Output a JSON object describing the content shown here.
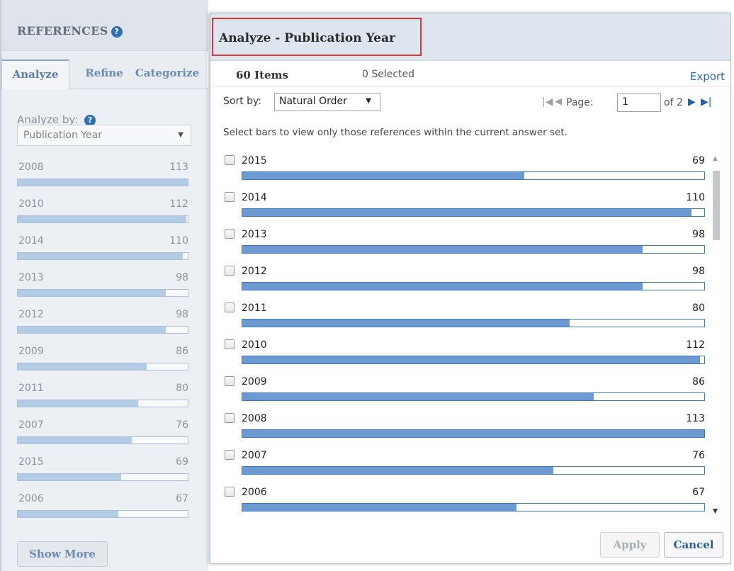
{
  "sidebar": {
    "title": "REFERENCES",
    "help_icon": "?",
    "tabs": [
      {
        "label": "Analyze",
        "active": true
      },
      {
        "label": "Refine",
        "active": false
      },
      {
        "label": "Categorize",
        "active": false
      }
    ],
    "analyze_by_label": "Analyze by:",
    "analyze_by_value": "Publication Year",
    "rows": [
      {
        "year": "2008",
        "count": "113",
        "fraction": 1.0
      },
      {
        "year": "2010",
        "count": "112",
        "fraction": 0.99
      },
      {
        "year": "2014",
        "count": "110",
        "fraction": 0.97
      },
      {
        "year": "2013",
        "count": "98",
        "fraction": 0.87
      },
      {
        "year": "2012",
        "count": "98",
        "fraction": 0.87
      },
      {
        "year": "2009",
        "count": "86",
        "fraction": 0.76
      },
      {
        "year": "2011",
        "count": "80",
        "fraction": 0.71
      },
      {
        "year": "2007",
        "count": "76",
        "fraction": 0.67
      },
      {
        "year": "2015",
        "count": "69",
        "fraction": 0.61
      },
      {
        "year": "2006",
        "count": "67",
        "fraction": 0.59
      }
    ],
    "show_more_label": "Show More"
  },
  "dialog": {
    "title": "Analyze - Publication Year",
    "items_count": "60 Items",
    "selected_count": "0 Selected",
    "export_label": "Export",
    "sort_label": "Sort by:",
    "sort_value": "Natural Order",
    "pager": {
      "page_label": "Page:",
      "current_page": "1",
      "total_label": "of 2"
    },
    "instructions": "Select bars to view only those references within the current answer set.",
    "rows": [
      {
        "year": "2015",
        "count": "69",
        "fraction": 0.61,
        "checked": false
      },
      {
        "year": "2014",
        "count": "110",
        "fraction": 0.973,
        "checked": false
      },
      {
        "year": "2013",
        "count": "98",
        "fraction": 0.867,
        "checked": false
      },
      {
        "year": "2012",
        "count": "98",
        "fraction": 0.867,
        "checked": false
      },
      {
        "year": "2011",
        "count": "80",
        "fraction": 0.708,
        "checked": false
      },
      {
        "year": "2010",
        "count": "112",
        "fraction": 0.991,
        "checked": false
      },
      {
        "year": "2009",
        "count": "86",
        "fraction": 0.761,
        "checked": false
      },
      {
        "year": "2008",
        "count": "113",
        "fraction": 1.0,
        "checked": false
      },
      {
        "year": "2007",
        "count": "76",
        "fraction": 0.673,
        "checked": false
      },
      {
        "year": "2006",
        "count": "67",
        "fraction": 0.593,
        "checked": false
      }
    ],
    "apply_label": "Apply",
    "cancel_label": "Cancel"
  },
  "colors": {
    "dialog_bar_fill": "#6d9bd1",
    "dialog_bar_border": "#3d79bc",
    "sidebar_bar_fill": "#b4cbe6",
    "title_highlight": "#e3343a",
    "link_blue": "#2a68b0"
  }
}
